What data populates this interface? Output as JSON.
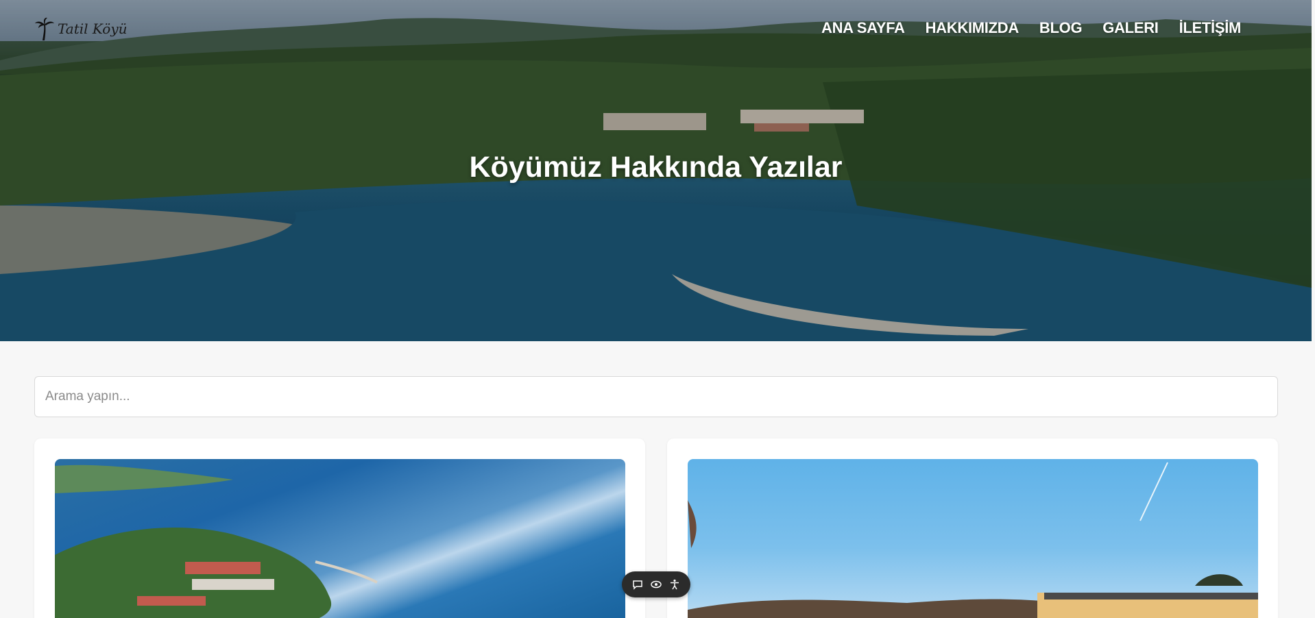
{
  "logo": {
    "text": "Tatil Köyü"
  },
  "nav": {
    "items": [
      {
        "label": "ANA SAYFA"
      },
      {
        "label": "HAKKIMIZDA"
      },
      {
        "label": "BLOG"
      },
      {
        "label": "GALERI"
      },
      {
        "label": "İLETİŞİM"
      }
    ]
  },
  "hero": {
    "title": "Köyümüz Hakkında Yazılar"
  },
  "search": {
    "placeholder": "Arama yapın..."
  },
  "widget": {
    "icons": [
      "chat-icon",
      "eye-icon",
      "accessibility-icon"
    ]
  }
}
